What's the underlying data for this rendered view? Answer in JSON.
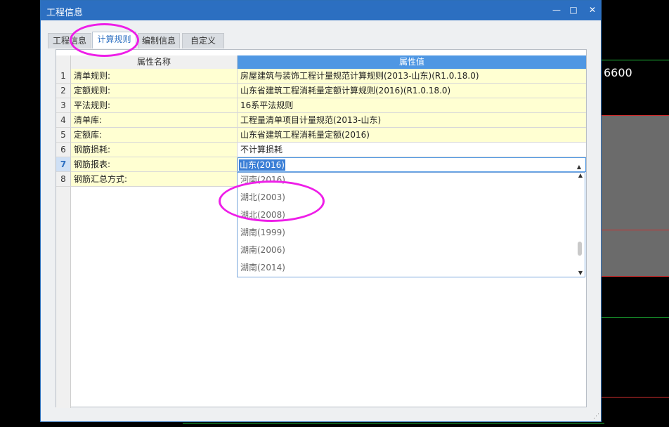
{
  "background": {
    "dimension_text": "6600"
  },
  "dialog": {
    "title": "工程信息",
    "controls": {
      "minimize": "—",
      "maximize": "□",
      "close": "✕"
    },
    "tabs": [
      {
        "label": "工程信息",
        "active": false
      },
      {
        "label": "计算规则",
        "active": true
      },
      {
        "label": "编制信息",
        "active": false
      },
      {
        "label": "自定义",
        "active": false
      }
    ],
    "grid": {
      "header_name": "属性名称",
      "header_value": "属性值",
      "rows": [
        {
          "num": "1",
          "name": "清单规则:",
          "value": "房屋建筑与装饰工程计量规范计算规则(2013-山东)(R1.0.18.0)"
        },
        {
          "num": "2",
          "name": "定额规则:",
          "value": "山东省建筑工程消耗量定额计算规则(2016)(R1.0.18.0)"
        },
        {
          "num": "3",
          "name": "平法规则:",
          "value": "16系平法规则"
        },
        {
          "num": "4",
          "name": "清单库:",
          "value": "工程量清单项目计量规范(2013-山东)"
        },
        {
          "num": "5",
          "name": "定额库:",
          "value": "山东省建筑工程消耗量定额(2016)"
        },
        {
          "num": "6",
          "name": "钢筋损耗:",
          "value": "不计算损耗"
        },
        {
          "num": "7",
          "name": "钢筋报表:",
          "value": "山东(2016)"
        },
        {
          "num": "8",
          "name": "钢筋汇总方式:",
          "value": ""
        }
      ]
    },
    "dropdown": {
      "options": [
        "河南(2016)",
        "湖北(2003)",
        "湖北(2008)",
        "湖南(1999)",
        "湖南(2006)",
        "湖南(2014)"
      ]
    }
  },
  "colors": {
    "titlebar": "#2c6fc1",
    "highlight_ellipse": "#ee1ee8",
    "row_fill": "#ffffd2"
  }
}
